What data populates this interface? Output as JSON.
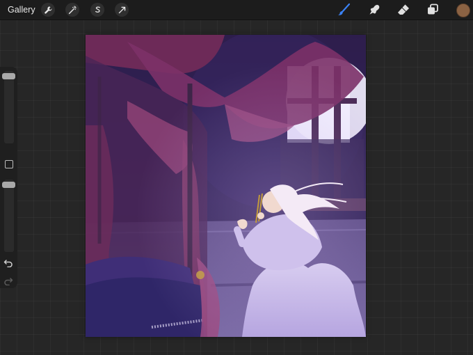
{
  "topbar": {
    "gallery_label": "Gallery",
    "left_tools": [
      "wrench-icon",
      "magic-wand-icon",
      "selection-s-icon",
      "transform-arrow-icon"
    ],
    "right_tools": [
      "brush-icon",
      "smudge-icon",
      "eraser-icon",
      "layers-icon"
    ],
    "active_tool": "brush",
    "active_color": "#8b6243",
    "accent_color": "#3b82f6"
  },
  "sidebar": {
    "brush_size_level": 0.04,
    "opacity_level": 0.12,
    "undo_icon": "undo-icon",
    "redo_icon": "redo-icon",
    "modify_icon": "square-modify-icon"
  },
  "canvas": {
    "artwork": "illustration"
  }
}
